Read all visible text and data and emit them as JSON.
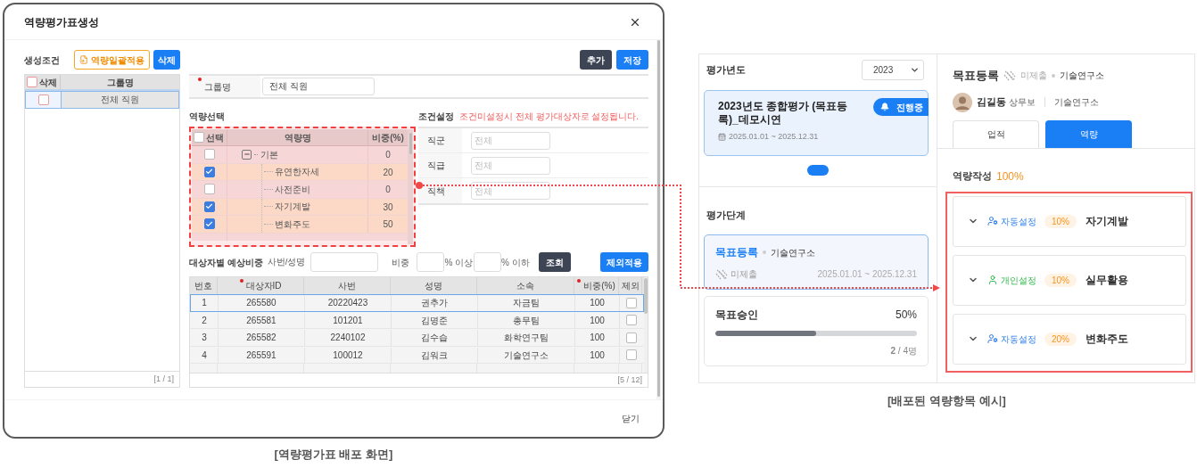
{
  "dialog": {
    "title": "역량평가표생성",
    "conditions_panel": {
      "label": "생성조건",
      "apply_button": "역량일괄적용",
      "delete_button": "삭제",
      "columns": [
        "삭제",
        "그룹명"
      ],
      "header_checked": false,
      "rows": [
        {
          "checked": false,
          "name": "전체 직원",
          "selected": true
        }
      ],
      "pager": "[1 / 1]"
    },
    "toolbar": {
      "add_button": "추가",
      "save_button": "저장"
    },
    "group_name": {
      "label": "그룹명",
      "required": true,
      "value": "전체 직원"
    },
    "competency": {
      "label": "역량선택",
      "columns": [
        "선택",
        "역량명",
        "비중(%)"
      ],
      "header_checked": false,
      "rows": [
        {
          "name": "기본",
          "checked": false,
          "weight": "0",
          "expanded": true,
          "children": [
            {
              "name": "유연한자세",
              "checked": true,
              "weight": "20"
            },
            {
              "name": "사전준비",
              "checked": false,
              "weight": "0"
            },
            {
              "name": "자기계발",
              "checked": true,
              "weight": "30"
            },
            {
              "name": "변화주도",
              "checked": true,
              "weight": "50"
            }
          ]
        }
      ]
    },
    "condition_settings": {
      "label": "조건설정",
      "note": "조건미설정시 전체 평가대상자로 설정됩니다.",
      "fields": [
        {
          "label": "직군",
          "placeholder": "전체"
        },
        {
          "label": "직급",
          "placeholder": "전체"
        },
        {
          "label": "직책",
          "placeholder": "전체"
        }
      ]
    },
    "targets": {
      "label": "대상자별 예상비중",
      "search_label": "사번/성명",
      "weight_label": "비중",
      "min_suffix": "% 이상",
      "max_suffix": "% 이하",
      "search_button": "조회",
      "exclude_button": "제외적용",
      "columns": [
        {
          "label": "번호",
          "required": false
        },
        {
          "label": "대상자ID",
          "required": true
        },
        {
          "label": "사번",
          "required": false
        },
        {
          "label": "성명",
          "required": false
        },
        {
          "label": "소속",
          "required": false
        },
        {
          "label": "비중(%)",
          "required": true
        },
        {
          "label": "제외",
          "required": false
        }
      ],
      "rows": [
        {
          "cells": [
            "1",
            "265580",
            "20220423",
            "권추가",
            "자금팀",
            "100"
          ],
          "excluded": false,
          "selected": true
        },
        {
          "cells": [
            "2",
            "265581",
            "101201",
            "김명준",
            "총무팀",
            "100"
          ],
          "excluded": false,
          "selected": false
        },
        {
          "cells": [
            "3",
            "265582",
            "2240102",
            "김수습",
            "화학연구팀",
            "100"
          ],
          "excluded": false,
          "selected": false
        },
        {
          "cells": [
            "4",
            "265591",
            "100012",
            "김워크",
            "기술연구소",
            "100"
          ],
          "excluded": false,
          "selected": false
        }
      ],
      "pager": "[5 / 12]"
    },
    "close_button": "닫기"
  },
  "caption_left": "[역량평가표 배포 화면]",
  "evaluation": {
    "year_label": "평가년도",
    "year": "2023",
    "card": {
      "title": "2023년도 종합평가 (목표등록)_데모시연",
      "period": "2025.01.01 ~ 2025.12.31",
      "badge": "진행중"
    },
    "stage_label": "평가단계",
    "stage": {
      "name": "목표등록",
      "org": "기술연구소",
      "status": "미제출",
      "period": "2025.01.01 ~ 2025.12.31"
    },
    "approval": {
      "title": "목표승인",
      "percent": "50%",
      "level": 0.5,
      "count": "**2** / 4명"
    }
  },
  "detail": {
    "title": "목표등록",
    "status": "미제출",
    "org": "기술연구소",
    "person": {
      "name": "김길동",
      "position": "상무보",
      "dept": "기술연구소"
    },
    "tabs": [
      {
        "label": "업적",
        "selected": false
      },
      {
        "label": "역량",
        "selected": true
      }
    ],
    "progress_label": "역량작성",
    "progress_value": "100%",
    "items": [
      {
        "kind": "auto",
        "setting": "자동설정",
        "weight": "10%",
        "name": "자기계발"
      },
      {
        "kind": "personal",
        "setting": "개인설정",
        "weight": "10%",
        "name": "실무활용"
      },
      {
        "kind": "auto",
        "setting": "자동설정",
        "weight": "20%",
        "name": "변화주도"
      }
    ]
  },
  "caption_right": "[배포된 역량항목 예시]"
}
